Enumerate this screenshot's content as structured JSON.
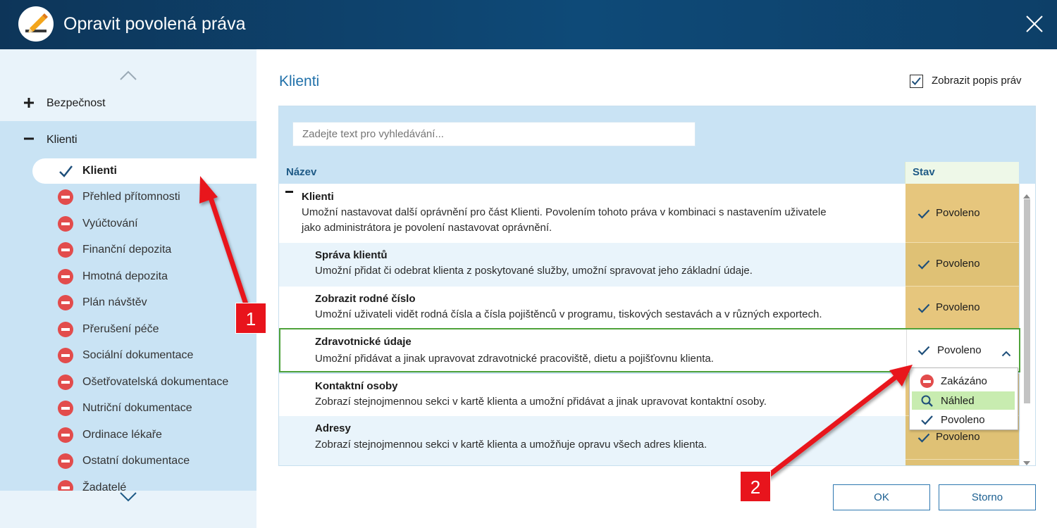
{
  "window": {
    "title": "Opravit povolená práva",
    "icon": "pencil-edit-icon",
    "close_icon": "close-icon"
  },
  "sidebar": {
    "groups": [
      {
        "label": "Bezpečnost",
        "state": "collapsed",
        "icon": "plus-icon"
      },
      {
        "label": "Klienti",
        "state": "expanded",
        "icon": "minus-icon"
      }
    ],
    "items": [
      {
        "label": "Klienti",
        "status": "allowed",
        "icon": "check-icon",
        "active": true
      },
      {
        "label": "Přehled přítomnosti",
        "status": "denied",
        "icon": "deny-icon"
      },
      {
        "label": "Vyúčtování",
        "status": "denied",
        "icon": "deny-icon"
      },
      {
        "label": "Finanční depozita",
        "status": "denied",
        "icon": "deny-icon"
      },
      {
        "label": "Hmotná depozita",
        "status": "denied",
        "icon": "deny-icon"
      },
      {
        "label": "Plán návštěv",
        "status": "denied",
        "icon": "deny-icon"
      },
      {
        "label": "Přerušení péče",
        "status": "denied",
        "icon": "deny-icon"
      },
      {
        "label": "Sociální dokumentace",
        "status": "denied",
        "icon": "deny-icon"
      },
      {
        "label": "Ošetřovatelská dokumentace",
        "status": "denied",
        "icon": "deny-icon"
      },
      {
        "label": "Nutriční dokumentace",
        "status": "denied",
        "icon": "deny-icon"
      },
      {
        "label": "Ordinace lékaře",
        "status": "denied",
        "icon": "deny-icon"
      },
      {
        "label": "Ostatní dokumentace",
        "status": "denied",
        "icon": "deny-icon"
      },
      {
        "label": "Žadatelé",
        "status": "denied",
        "icon": "deny-icon"
      }
    ]
  },
  "main": {
    "title": "Klienti",
    "show_description": {
      "label": "Zobrazit popis práv",
      "checked": true
    },
    "search": {
      "placeholder": "Zadejte text pro vyhledávání...",
      "value": ""
    },
    "columns": {
      "name": "Název",
      "state": "Stav"
    },
    "rows": [
      {
        "title": "Klienti",
        "desc_lines": [
          "Umožní nastavovat další oprávnění pro část Klienti. Povolením tohoto práva v kombinaci s nastavením uživatele",
          "jako administrátora je povolení nastavovat oprávnění."
        ],
        "state": "Povoleno",
        "level": 0
      },
      {
        "title": "Správa klientů",
        "description": "Umožní přidat či odebrat klienta z poskytované služby, umožní spravovat jeho základní údaje.",
        "state": "Povoleno",
        "level": 1
      },
      {
        "title": "Zobrazit rodné číslo",
        "description": "Umožní uživateli vidět rodná čísla a čísla pojištěnců v programu, tiskových sestavách a v různých exportech.",
        "state": "Povoleno",
        "level": 1
      },
      {
        "title": "Zdravotnické údaje",
        "description": "Umožní přidávat a jinak upravovat zdravotnické pracoviště, dietu a pojišťovnu klienta.",
        "state": "Povoleno",
        "level": 1,
        "selected": true
      },
      {
        "title": "Kontaktní osoby",
        "description": "Zobrazí stejnojmennou sekci v kartě klienta a umožní přidávat a jinak upravovat kontaktní osoby.",
        "state": "",
        "level": 1
      },
      {
        "title": "Adresy",
        "description": "Zobrazí stejnojmennou sekci v kartě klienta a umožňuje opravu všech adres klienta.",
        "state": "Povoleno",
        "level": 1
      }
    ],
    "dropdown_options": [
      {
        "label": "Zakázáno",
        "icon": "deny-icon"
      },
      {
        "label": "Náhled",
        "icon": "magnifier-icon",
        "highlighted": true
      },
      {
        "label": "Povoleno",
        "icon": "check-icon"
      }
    ]
  },
  "buttons": {
    "ok": "OK",
    "cancel": "Storno"
  },
  "annotations": [
    {
      "number": "1"
    },
    {
      "number": "2"
    }
  ],
  "colors": {
    "titlebar": "#0e4a78",
    "accent": "#2171aa",
    "sidebar_bg": "#e9f3fa",
    "sidebar_selected_group": "#c9e3f4",
    "state_allowed_bg": "#e6c67d",
    "denied_red": "#e24c4c",
    "selection_green": "#4fa23a",
    "annotation_red": "#e8141c"
  }
}
